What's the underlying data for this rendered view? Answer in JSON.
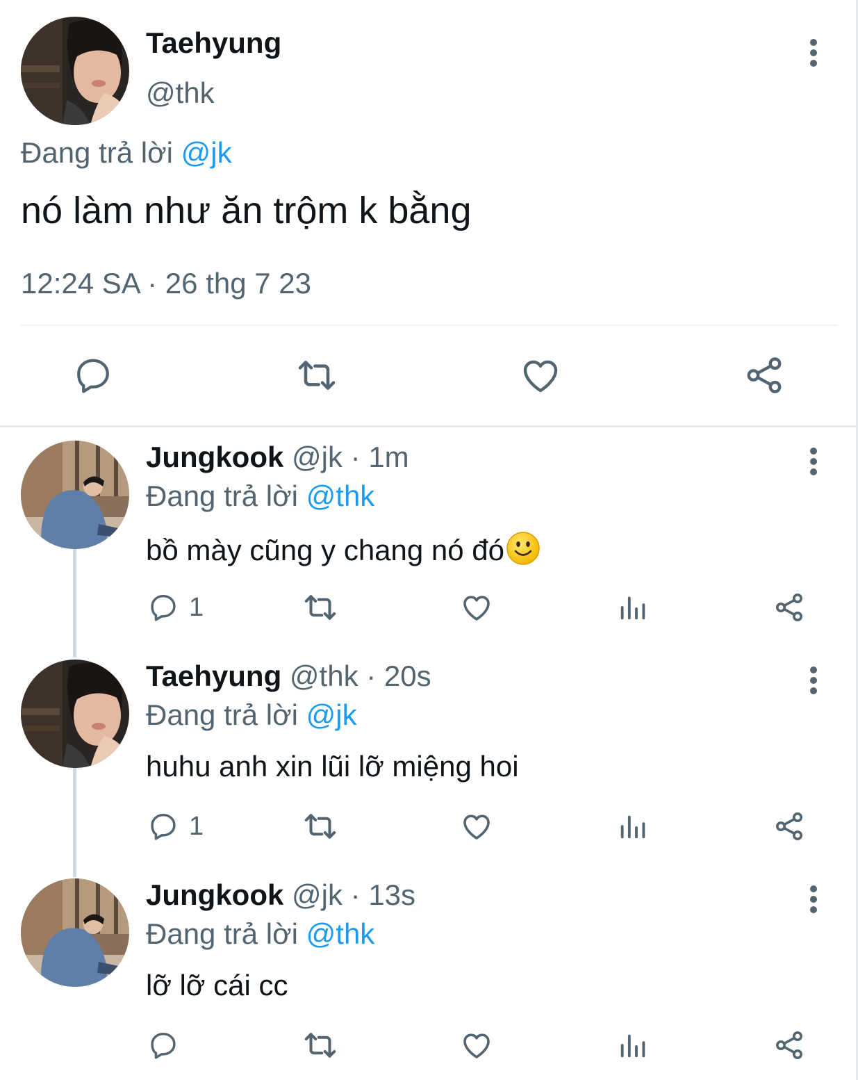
{
  "main_tweet": {
    "name": "Taehyung",
    "handle": "@thk",
    "replying_prefix": "Đang trả lời",
    "replying_to": "@jk",
    "text": "nó làm như ăn trộm k bằng",
    "timestamp": "12:24 SA · 26 thg 7 23",
    "actions": [
      "reply-icon",
      "retweet-icon",
      "like-icon",
      "share-icon"
    ]
  },
  "replies": [
    {
      "name": "Jungkook",
      "meta": "@jk · 1m",
      "replying_prefix": "Đang trả lời",
      "replying_to": "@thk",
      "text": "bồ mày cũng y chang nó đó",
      "emoji": "slightly-smiling-face",
      "reply_count": "1"
    },
    {
      "name": "Taehyung",
      "meta": "@thk · 20s",
      "replying_prefix": "Đang trả lời",
      "replying_to": "@jk",
      "text": "huhu anh xin lũi lỡ miệng hoi",
      "reply_count": "1"
    },
    {
      "name": "Jungkook",
      "meta": "@jk · 13s",
      "replying_prefix": "Đang trả lời",
      "replying_to": "@thk",
      "text": "lỡ lỡ cái cc",
      "reply_count": ""
    }
  ],
  "colors": {
    "text_primary": "#0f1419",
    "text_secondary": "#536471",
    "mention": "#1d9bf0",
    "divider": "#eff3f4",
    "thread_line": "#cfd9de"
  }
}
